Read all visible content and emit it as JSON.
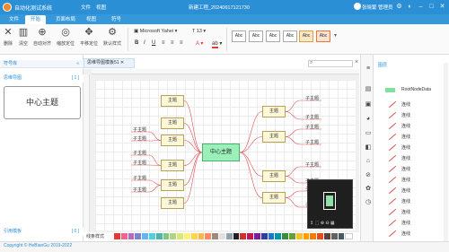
{
  "app": {
    "title": "自动化测试系统",
    "menus": [
      "文件",
      "视图"
    ],
    "document_title": "新建工程_20240617121730",
    "user": "张晓繁 管理员"
  },
  "tabs": [
    {
      "label": "文件",
      "active": false
    },
    {
      "label": "开始",
      "active": true
    },
    {
      "label": "页面布局",
      "active": false
    },
    {
      "label": "视图",
      "active": false
    },
    {
      "label": "符号",
      "active": false
    }
  ],
  "toolbar": {
    "buttons": [
      {
        "label": "删除",
        "icon": "delete-icon"
      },
      {
        "label": "清空",
        "icon": "clear-icon"
      },
      {
        "label": "自动对齐",
        "icon": "align-icon"
      },
      {
        "label": "缩放定位",
        "icon": "zoom-fit-icon"
      },
      {
        "label": "平移定位",
        "icon": "pan-icon"
      },
      {
        "label": "默认样式",
        "icon": "default-style-icon"
      }
    ],
    "font_family": "Microsoft Yahei",
    "font_size": "T 13",
    "font_color_label": "A",
    "highlight_label": "ab",
    "style_presets": [
      "Abc",
      "Abc",
      "Abc",
      "Abc",
      "Abc",
      "Abc"
    ]
  },
  "left_panel": {
    "header": "符号库",
    "section_title": "思维导图",
    "section_count": "1",
    "topic_label": "中心主题",
    "footer_title": "引用模板",
    "footer_count": "0"
  },
  "canvas": {
    "doc_tab": "思维导图模板51",
    "center_topic": "中心主题",
    "left_topics": [
      "主题",
      "主题",
      "主题",
      "主题",
      "主题",
      "主题"
    ],
    "right_topics": [
      "主题",
      "主题",
      "主题",
      "主题"
    ],
    "leaf_label": "子主题",
    "pen_label": "线条样式"
  },
  "outline": {
    "header": "图层",
    "root": "RootNodeData",
    "items": [
      "连线",
      "连线",
      "连线",
      "连线",
      "连线",
      "连线",
      "连线",
      "连线",
      "连线",
      "连线",
      "连线",
      "连线",
      "连线"
    ]
  },
  "footer": {
    "copyright": "Copyright © HeBianGu 2019-2022"
  },
  "palette": [
    "#e53935",
    "#f06292",
    "#ba68c8",
    "#7986cb",
    "#64b5f6",
    "#4dd0e1",
    "#4db6ac",
    "#81c784",
    "#aed581",
    "#dce775",
    "#fff176",
    "#ffd54f",
    "#ffb74d",
    "#ff8a65",
    "#a1887f",
    "#e0e0e0",
    "#90a4ae",
    "#212121",
    "#d32f2f",
    "#c2185b",
    "#7b1fa2",
    "#303f9f",
    "#1976d2",
    "#0097a7",
    "#388e3c",
    "#689f38",
    "#fbc02d",
    "#ffa000",
    "#f57c00",
    "#e64a19",
    "#5d4037",
    "#616161",
    "#455a64",
    "#ffffff"
  ],
  "colors": {
    "accent": "#2b8fd6",
    "node_fill": "#fff8d8",
    "center_fill": "#9af0b8",
    "link": "#e05050"
  }
}
